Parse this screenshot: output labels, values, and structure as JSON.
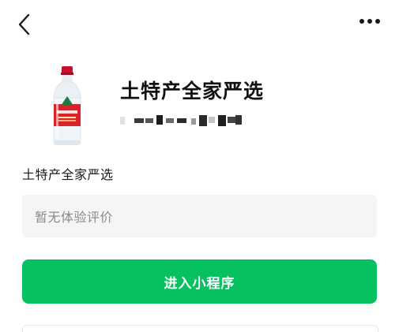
{
  "top_bar": {
    "back_icon": "chevron-left-icon",
    "more_icon": "ellipsis-icon"
  },
  "header": {
    "title": "土特产全家严选",
    "product_icon": "water-bottle-image"
  },
  "mini_program": {
    "name": "土特产全家严选"
  },
  "review": {
    "placeholder": "暂无体验评价"
  },
  "actions": {
    "enter_label": "进入小程序"
  },
  "colors": {
    "accent": "#07c160",
    "bottle_red": "#d8232a",
    "review_bg": "#f5f5f5"
  }
}
